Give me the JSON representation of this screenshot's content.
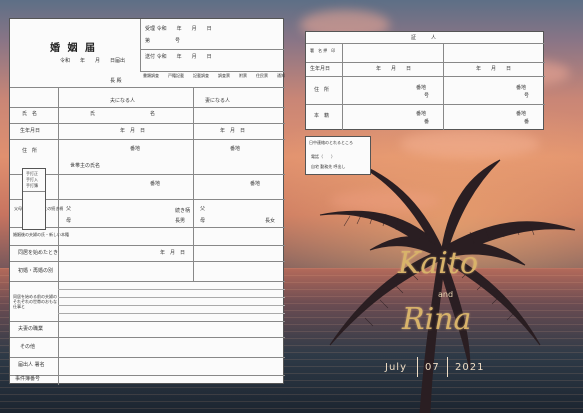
{
  "form": {
    "title": "婚 姻 届",
    "received_row": "受理 令和　　年　　月　　日",
    "number_label": "第　　　　　号",
    "sent_row": "送付 令和　　年　　月　　日",
    "date_row": "令和　　年　　月　　日届出",
    "chief_label": "長 殿",
    "check_row": [
      "書類調査",
      "戸籍記載",
      "記載調査",
      "調査票",
      "附票",
      "住民票",
      "通知"
    ],
    "col_husband": "夫になる人",
    "col_wife": "妻になる人",
    "row_labels": [
      "氏　名",
      "生年月日",
      "住　所",
      "本　籍",
      "父母の氏名 父母との続き柄",
      "婚姻後の夫婦の氏・新しい本籍",
      "同居を始めたとき",
      "初婚・再婚の別",
      "同居を始める前の夫婦のそれぞれの世帯のおもな仕事と",
      "夫妻の職業",
      "その他",
      "届出人 署名",
      "事件簿番号"
    ],
    "field_texts": [
      "氏",
      "名",
      "年　月　日",
      "番地",
      "番",
      "号",
      "世帯主の氏名",
      "父",
      "母",
      "続き柄",
      "長男",
      "長女"
    ],
    "side_labels": [
      "手打正",
      "手打入",
      "手打簿"
    ]
  },
  "witness": {
    "title": "証　　　人",
    "labels": [
      "署　名 押　印",
      "生年月日",
      "住　所",
      "本　籍"
    ],
    "date": "年　　月　　日",
    "field_texts": [
      "番地",
      "番",
      "号"
    ]
  },
  "contact": {
    "title": "日中連絡のとれるところ",
    "phone": "電話（　　）",
    "options": "自宅 勤務先 呼出し"
  },
  "couple": {
    "name1": "Kaito",
    "conj": "and",
    "name2": "Rina"
  },
  "date": {
    "month": "July",
    "day": "07",
    "year": "2021"
  },
  "colors": {
    "gold": "#d8b36a",
    "paper": "#fbfbfb",
    "sky_top": "#5d6f86",
    "sunset": "#e0906f"
  }
}
